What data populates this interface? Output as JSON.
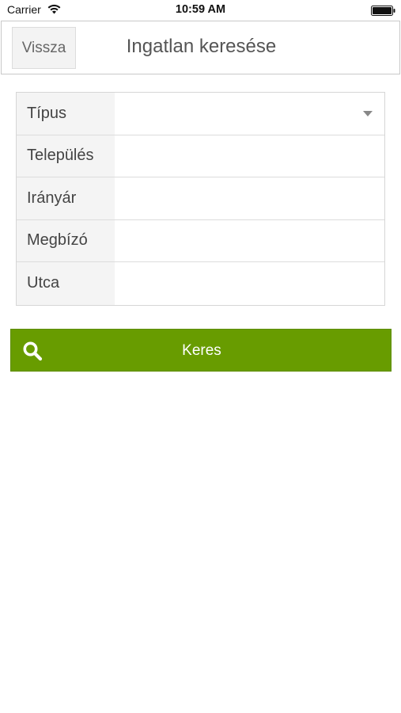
{
  "status_bar": {
    "carrier": "Carrier",
    "time": "10:59 AM"
  },
  "header": {
    "back_label": "Vissza",
    "title": "Ingatlan keresése"
  },
  "form": {
    "fields": [
      {
        "label": "Típus",
        "kind": "select",
        "value": ""
      },
      {
        "label": "Település",
        "kind": "text",
        "value": ""
      },
      {
        "label": "Irányár",
        "kind": "text",
        "value": ""
      },
      {
        "label": "Megbízó",
        "kind": "text",
        "value": ""
      },
      {
        "label": "Utca",
        "kind": "text",
        "value": ""
      }
    ]
  },
  "search_button": {
    "label": "Keres"
  },
  "colors": {
    "accent": "#689c00",
    "label_background": "#f4f4f4",
    "border": "#d6d6d6"
  }
}
